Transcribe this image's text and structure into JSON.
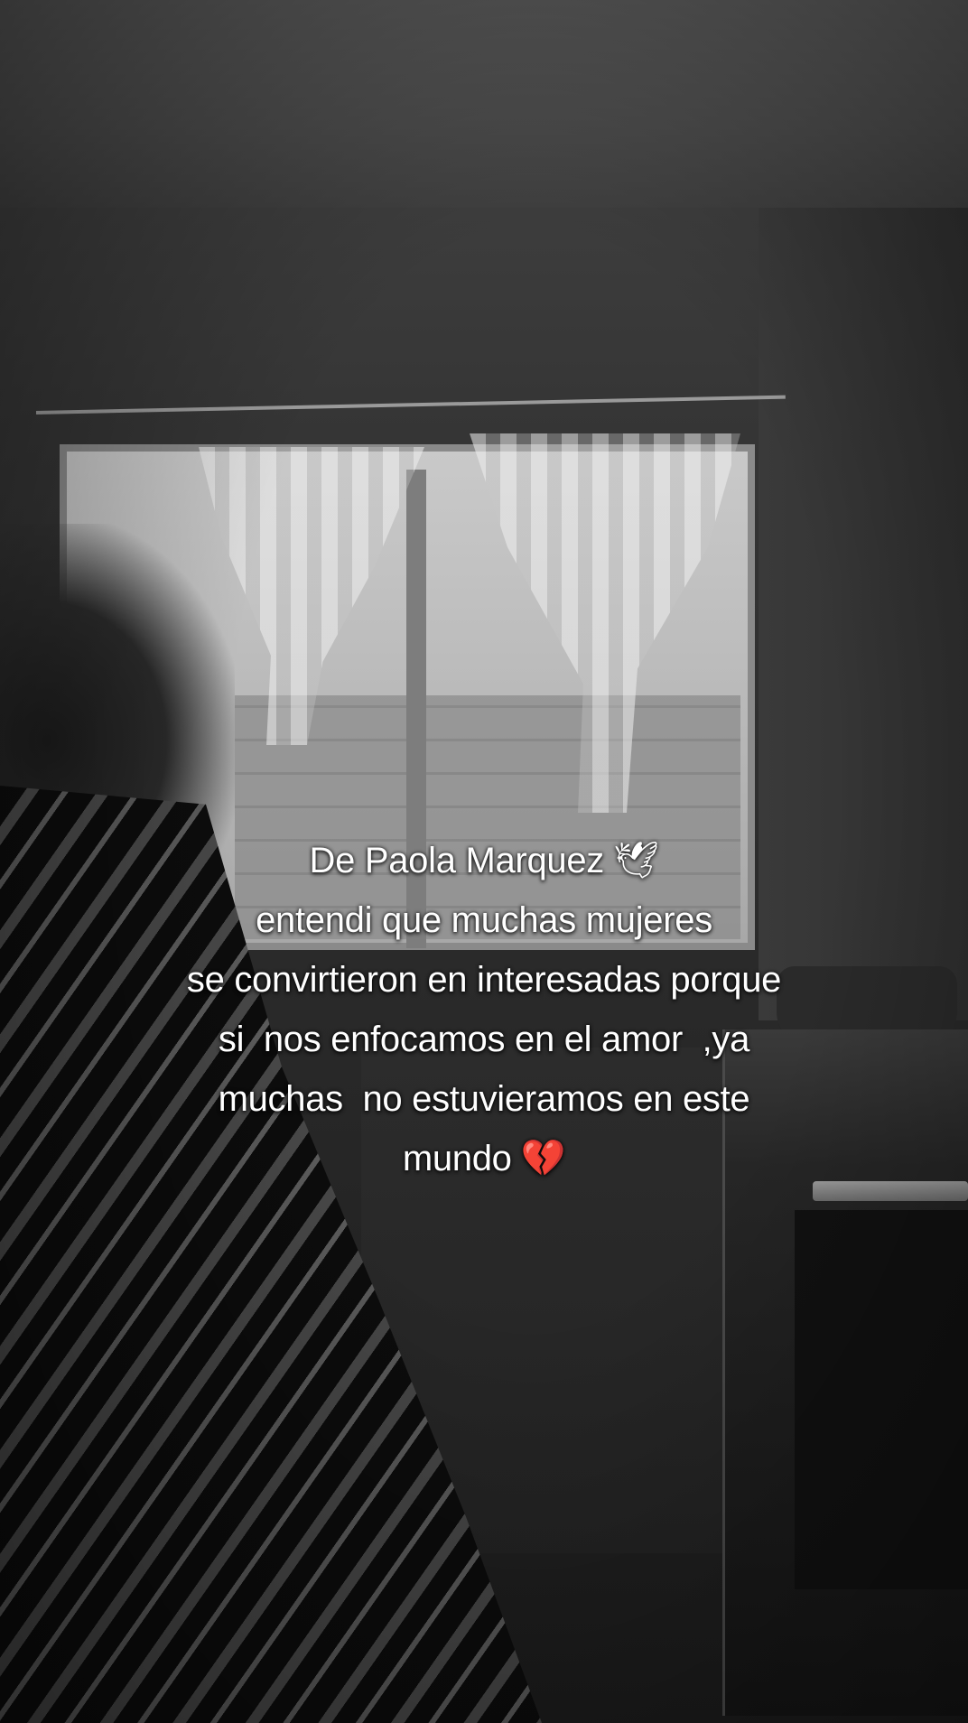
{
  "caption": {
    "line1": "De Paola Marquez",
    "line1_icon": "dove-icon",
    "line2": "entendi que muchas mujeres",
    "line3": "se convirtieron en interesadas porque",
    "line4": "si  nos enfocamos en el amor  ,ya",
    "line5": "muchas  no estuvieramos en este",
    "line6": "mundo",
    "line6_icon": "broken-heart-icon",
    "text_color": "#ffffff"
  },
  "icons": {
    "dove": "🕊",
    "broken_heart": "💔",
    "broken_heart_color": "#e23b7a"
  },
  "scene": {
    "tone": "black-and-white"
  }
}
